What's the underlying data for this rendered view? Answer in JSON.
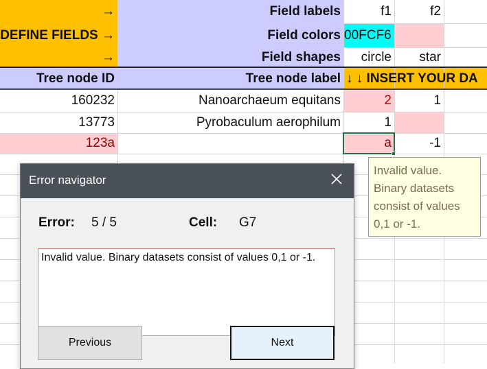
{
  "sheet": {
    "rows": {
      "field_labels": {
        "arrow": "→",
        "label": "Field labels",
        "f1": "f1",
        "f2": "f2"
      },
      "field_colors": {
        "define": "DEFINE FIELDS →",
        "label": "Field colors",
        "f1": "00FCF6",
        "f2": ""
      },
      "field_shapes": {
        "arrow": "→",
        "label": "Field shapes",
        "f1": "circle",
        "f2": "star"
      },
      "header": {
        "id": "Tree node ID",
        "label": "Tree node label",
        "insert": "↓ ↓ INSERT YOUR DA"
      },
      "data": [
        {
          "id": "160232",
          "label": "Nanoarchaeum equitans",
          "f1": "2",
          "f2": "1"
        },
        {
          "id": "13773",
          "label": "Pyrobaculum aerophilum",
          "f1": "1",
          "f2": ""
        },
        {
          "id": "123a",
          "label": "",
          "f1": "a",
          "f2": "-1"
        }
      ]
    },
    "colors": {
      "orange": "#ffc000",
      "lavender": "#ccccff",
      "cyan": "#00fcf6",
      "error_pink": "#ffcdd2",
      "selection_green": "#217346"
    }
  },
  "tooltip": {
    "lines": [
      "Invalid value.",
      "Binary datasets",
      "consist of values",
      "0,1 or -1."
    ]
  },
  "dialog": {
    "title": "Error navigator",
    "close_icon": "close-icon",
    "error_label": "Error:",
    "error_value": "5 / 5",
    "cell_label": "Cell:",
    "cell_value": "G7",
    "message": "Invalid value. Binary datasets consist of values 0,1 or -1.",
    "previous_label": "Previous",
    "next_label": "Next"
  }
}
